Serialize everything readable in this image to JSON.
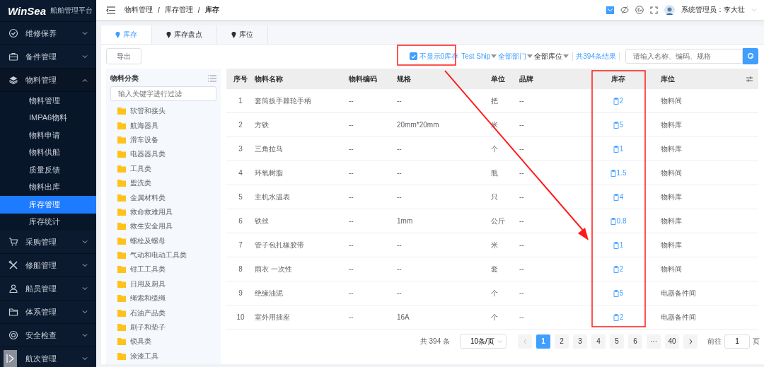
{
  "app": {
    "logo": "WinSea",
    "subtitle": "船舶管理平台"
  },
  "sidebar": {
    "items": [
      {
        "label": "维修保养",
        "expanded": false
      },
      {
        "label": "备件管理",
        "expanded": false
      },
      {
        "label": "物料管理",
        "expanded": true,
        "children": [
          {
            "label": "物料管理",
            "selected": false
          },
          {
            "label": "IMPA6物料",
            "selected": false
          },
          {
            "label": "物料申请",
            "selected": false
          },
          {
            "label": "物料供船",
            "selected": false
          },
          {
            "label": "质量反馈",
            "selected": false
          },
          {
            "label": "物料出库",
            "selected": false
          },
          {
            "label": "库存管理",
            "selected": true
          },
          {
            "label": "库存统计",
            "selected": false
          }
        ]
      },
      {
        "label": "采购管理",
        "expanded": false
      },
      {
        "label": "修船管理",
        "expanded": false
      },
      {
        "label": "船员管理",
        "expanded": false
      },
      {
        "label": "体系管理",
        "expanded": false
      },
      {
        "label": "安全检查",
        "expanded": false
      },
      {
        "label": "航次管理",
        "expanded": false
      }
    ]
  },
  "header": {
    "breadcrumb": [
      "物料管理",
      "库存管理",
      "库存"
    ],
    "breadcrumb_separator": "/",
    "user": "系统管理员：李大壮"
  },
  "tabs": [
    {
      "label": "库存",
      "selected": true
    },
    {
      "label": "库存盘点",
      "selected": false
    },
    {
      "label": "库位",
      "selected": false
    }
  ],
  "toolbar": {
    "export": "导出",
    "zero_filter": {
      "label": "不显示0库存",
      "checked": true
    },
    "dropdowns": [
      {
        "label": "Test Ship",
        "highlighted": true
      },
      {
        "label": "全部部门",
        "highlighted": true
      },
      {
        "label": "全部库位",
        "highlighted": false
      }
    ],
    "result_count": "共394条结果",
    "search": {
      "placeholder": "请输入名称、编码、规格"
    }
  },
  "categories": {
    "title": "物料分类",
    "filter": {
      "placeholder": "输入关键字进行过滤"
    },
    "items": [
      "软管和接头",
      "航海器具",
      "滑车设备",
      "电器器具类",
      "工具类",
      "盥洗类",
      "金属材料类",
      "救命救难用具",
      "救生安全用具",
      "螺栓及螺母",
      "气动和电动工具类",
      "钳工工具类",
      "日用及厨具",
      "绳索和缆绳",
      "石油产品类",
      "刷子和垫子",
      "锁具类",
      "涂漆工具"
    ]
  },
  "table": {
    "columns": [
      "序号",
      "物料名称",
      "物料编码",
      "规格",
      "单位",
      "品牌",
      "库存",
      "库位"
    ],
    "rows": [
      {
        "no": "1",
        "name": "套筒扳手棘轮手柄",
        "code": "--",
        "spec": "--",
        "unit": "把",
        "brand": "--",
        "stock": "2",
        "location": "物料间"
      },
      {
        "no": "2",
        "name": "方铁",
        "code": "--",
        "spec": "20mm*20mm",
        "unit": "米",
        "brand": "--",
        "stock": "5",
        "location": "物料库"
      },
      {
        "no": "3",
        "name": "三角拉马",
        "code": "--",
        "spec": "--",
        "unit": "个",
        "brand": "--",
        "stock": "1",
        "location": "物料库"
      },
      {
        "no": "4",
        "name": "环氧树脂",
        "code": "--",
        "spec": "--",
        "unit": "瓶",
        "brand": "--",
        "stock": "1.5",
        "location": "物料间"
      },
      {
        "no": "5",
        "name": "主机水温表",
        "code": "--",
        "spec": "--",
        "unit": "只",
        "brand": "--",
        "stock": "4",
        "location": "物料库"
      },
      {
        "no": "6",
        "name": "铁丝",
        "code": "--",
        "spec": "1mm",
        "unit": "公斤",
        "brand": "--",
        "stock": "0.8",
        "location": "物料库"
      },
      {
        "no": "7",
        "name": "管子包扎橡胶带",
        "code": "--",
        "spec": "--",
        "unit": "米",
        "brand": "--",
        "stock": "1",
        "location": "物料库"
      },
      {
        "no": "8",
        "name": "雨衣 一次性",
        "code": "--",
        "spec": "--",
        "unit": "套",
        "brand": "--",
        "stock": "2",
        "location": "物料间"
      },
      {
        "no": "9",
        "name": "绝缘油泥",
        "code": "--",
        "spec": "--",
        "unit": "个",
        "brand": "--",
        "stock": "5",
        "location": "电器备件间"
      },
      {
        "no": "10",
        "name": "室外用插座",
        "code": "--",
        "spec": "16A",
        "unit": "个",
        "brand": "--",
        "stock": "2",
        "location": "电器备件间"
      }
    ]
  },
  "pagination": {
    "total": "共 394 条",
    "page_size": "10条/页",
    "pages": [
      {
        "label": "1",
        "selected": true
      },
      {
        "label": "2",
        "selected": false
      },
      {
        "label": "3",
        "selected": false
      },
      {
        "label": "4",
        "selected": false
      },
      {
        "label": "5",
        "selected": false
      },
      {
        "label": "6",
        "selected": false
      },
      {
        "label": "···",
        "selected": false
      },
      {
        "label": "40",
        "selected": false
      }
    ],
    "goto_label": "前往",
    "goto_value": "1",
    "goto_suffix": "页"
  }
}
